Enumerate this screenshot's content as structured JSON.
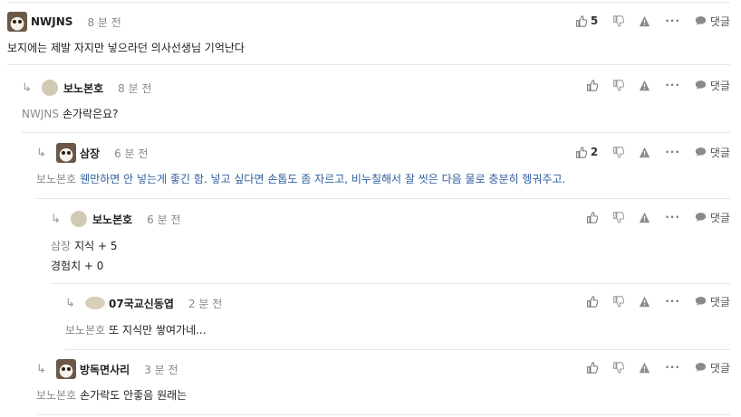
{
  "comments": [
    {
      "nick": "NWJNS",
      "time": "8 분 전",
      "mention": "",
      "text": "보지에는 제발 자지만 넣으라던 의사선생님 기억난다",
      "likes": "5",
      "reply": "댓글"
    },
    {
      "nick": "보노본호",
      "time": "8 분 전",
      "mention": "NWJNS",
      "text": "손가락은요?",
      "likes": "",
      "reply": "댓글"
    },
    {
      "nick": "삼장",
      "time": "6 분 전",
      "mention": "보노본호",
      "text": "웬만하면 안 넣는게 좋긴 함. 넣고 싶다면 손톱도 좀 자르고, 비누칠해서 잘 씻은 다음 물로 충분히 헹궈주고.",
      "likes": "2",
      "reply": "댓글"
    },
    {
      "nick": "보노본호",
      "time": "6 분 전",
      "mention": "삼장",
      "text": "지식 + 5",
      "text2": "경험치 + 0",
      "likes": "",
      "reply": "댓글"
    },
    {
      "nick": "07국교신동엽",
      "time": "2 분 전",
      "mention": "보노본호",
      "text": "또 지식만 쌓여가네...",
      "likes": "",
      "reply": "댓글"
    },
    {
      "nick": "방독면사리",
      "time": "3 분 전",
      "mention": "보노본호",
      "text": "손가락도 안좋음 원래는",
      "likes": "",
      "reply": "댓글"
    }
  ]
}
